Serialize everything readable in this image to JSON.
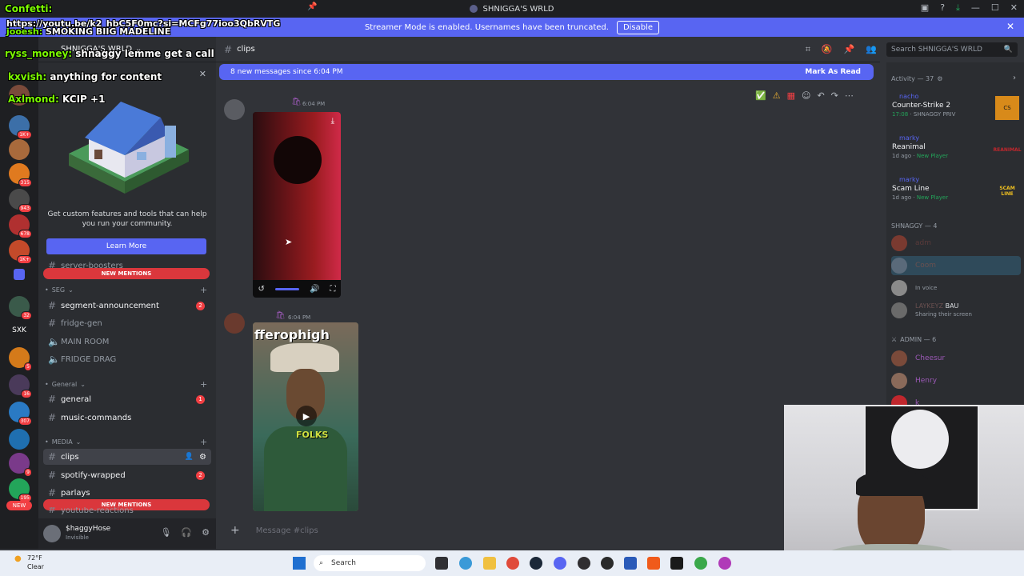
{
  "window": {
    "title": "SHNIGGA'S WRLD"
  },
  "streamer_mode": {
    "message": "Streamer Mode is enabled. Usernames have been truncated.",
    "disable_label": "Disable"
  },
  "server": {
    "name": "SHNIGGA'S WRLD"
  },
  "promo": {
    "text": "Get custom features and tools that can help you run your community.",
    "button": "Learn More"
  },
  "sidebar": {
    "new_mentions_top": "NEW MENTIONS",
    "new_mentions_bottom": "NEW MENTIONS",
    "partial_top": "server-boosters",
    "categories": {
      "seg": "SEG",
      "general": "General",
      "media": "MEDIA"
    },
    "channels": [
      {
        "name": "segment-announcement",
        "badge": "2",
        "type": "text"
      },
      {
        "name": "fridge-gen",
        "badge": "",
        "type": "text"
      },
      {
        "name": "MAIN ROOM",
        "badge": "",
        "type": "voice"
      },
      {
        "name": "FRIDGE DRAG",
        "badge": "",
        "type": "voice"
      },
      {
        "name": "general",
        "badge": "1",
        "type": "text"
      },
      {
        "name": "music-commands",
        "badge": "",
        "type": "text"
      },
      {
        "name": "clips",
        "badge": "",
        "type": "text"
      },
      {
        "name": "spotify-wrapped",
        "badge": "2",
        "type": "text"
      },
      {
        "name": "parlays",
        "badge": "",
        "type": "text"
      }
    ],
    "partial_bottom": "youtube-reactions"
  },
  "user": {
    "name": "$haggyHose",
    "status": "Invisible"
  },
  "channel_header": {
    "name": "clips"
  },
  "search": {
    "placeholder": "Search SHNIGGA'S WRLD"
  },
  "new_messages": {
    "text": "8 new messages since 6:04 PM",
    "action": "Mark As Read"
  },
  "messages": [
    {
      "time": "6:04 PM"
    },
    {
      "time": "6:04 PM"
    }
  ],
  "video2_overlay": {
    "caption_top": "fferophigh",
    "caption_mid": "FOLKS"
  },
  "composer": {
    "placeholder": "Message #clips"
  },
  "members": {
    "activity_label": "Activity — 37",
    "activities": [
      {
        "user": "nacho",
        "game": "Counter-Strike 2",
        "meta_time": "17:08",
        "meta_rest": "SHNAGGY PRIV",
        "thumb": "CS"
      },
      {
        "user": "marky",
        "game": "Reanimal",
        "meta_time": "1d ago",
        "meta_rest": "New Player",
        "thumb": "REANIMAL"
      },
      {
        "user": "marky",
        "game": "Scam Line",
        "meta_time": "1d ago",
        "meta_rest": "New Player",
        "thumb": "SCAM LINE"
      }
    ],
    "shnaggy_label": "SHNAGGY — 4",
    "shnaggy": [
      {
        "name": "adm",
        "sub": ""
      },
      {
        "name": "Coom",
        "sub": ""
      },
      {
        "name": "",
        "sub": "In voice"
      },
      {
        "name": "LAYKEYZ",
        "tag": "BAU",
        "sub": "Sharing their screen"
      }
    ],
    "admin_label": "ADMIN — 6",
    "admins": [
      {
        "name": "Cheesur"
      },
      {
        "name": "Henry"
      },
      {
        "name": "k"
      }
    ]
  },
  "overlay_chat": [
    {
      "name": "Confetti:",
      "text": ""
    },
    {
      "name": "",
      "text": "https://youtu.be/k2_hbC5F0mc?si=MCFg77ioo3QbRVTG"
    },
    {
      "name": "jooesh:",
      "text": "SMOKING BIIG MADELINE"
    },
    {
      "name": "ryss_money:",
      "text": "shnaggy lemme get a call"
    },
    {
      "name": "kxvish:",
      "text": "anything for content"
    },
    {
      "name": "Axlmond:",
      "text": "KCIP +1"
    }
  ],
  "taskbar": {
    "temp": "72°F",
    "condition": "Clear",
    "search": "Search"
  },
  "rail_badges": [
    "1K+",
    "315",
    "943",
    "678",
    "1K+",
    "32",
    "SXK",
    "5",
    "16",
    "307",
    "9",
    "195",
    "NEW"
  ],
  "colors": {
    "blurple": "#5865f2",
    "red": "#f23f43",
    "bg": "#313338",
    "sidebar": "#2b2d31"
  }
}
